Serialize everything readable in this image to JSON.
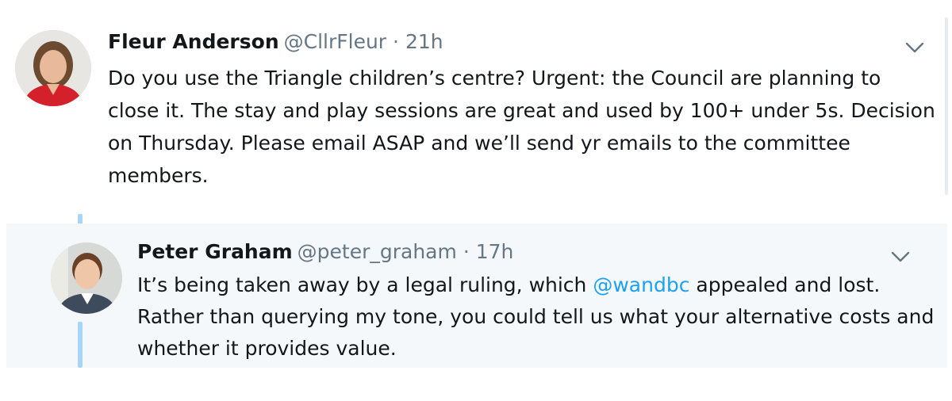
{
  "tweets": [
    {
      "name": "Fleur Anderson",
      "handle": "@CllrFleur",
      "separator": "·",
      "time": "21h",
      "lines": [
        "Do you use the Triangle children’s centre? Urgent: the Council are planning to",
        "close it. The stay and play sessions are great and used by 100+ under 5s. Decision",
        "on Thursday. Please email ASAP and we’ll send yr emails to the committee",
        "members."
      ],
      "avatar_icon": "avatar-woman-red-jacket",
      "menu_icon": "chevron-down-icon"
    },
    {
      "name": "Peter Graham",
      "handle": "@peter_graham",
      "separator": "·",
      "time": "17h",
      "line1_before": "It’s being taken away by a legal ruling, which ",
      "line1_mention": "@wandbc",
      "line1_after": " appealed and lost.",
      "line2": "Rather than querying my tone, you could tell us what your alternative costs and",
      "line3": "whether it provides value.",
      "avatar_icon": "avatar-man-suit",
      "menu_icon": "chevron-down-icon"
    }
  ],
  "colors": {
    "text": "#14171a",
    "secondary": "#657786",
    "link": "#1da1f2",
    "thread_line": "#a9d4f5",
    "highlight_bg": "#f5f8fa"
  }
}
